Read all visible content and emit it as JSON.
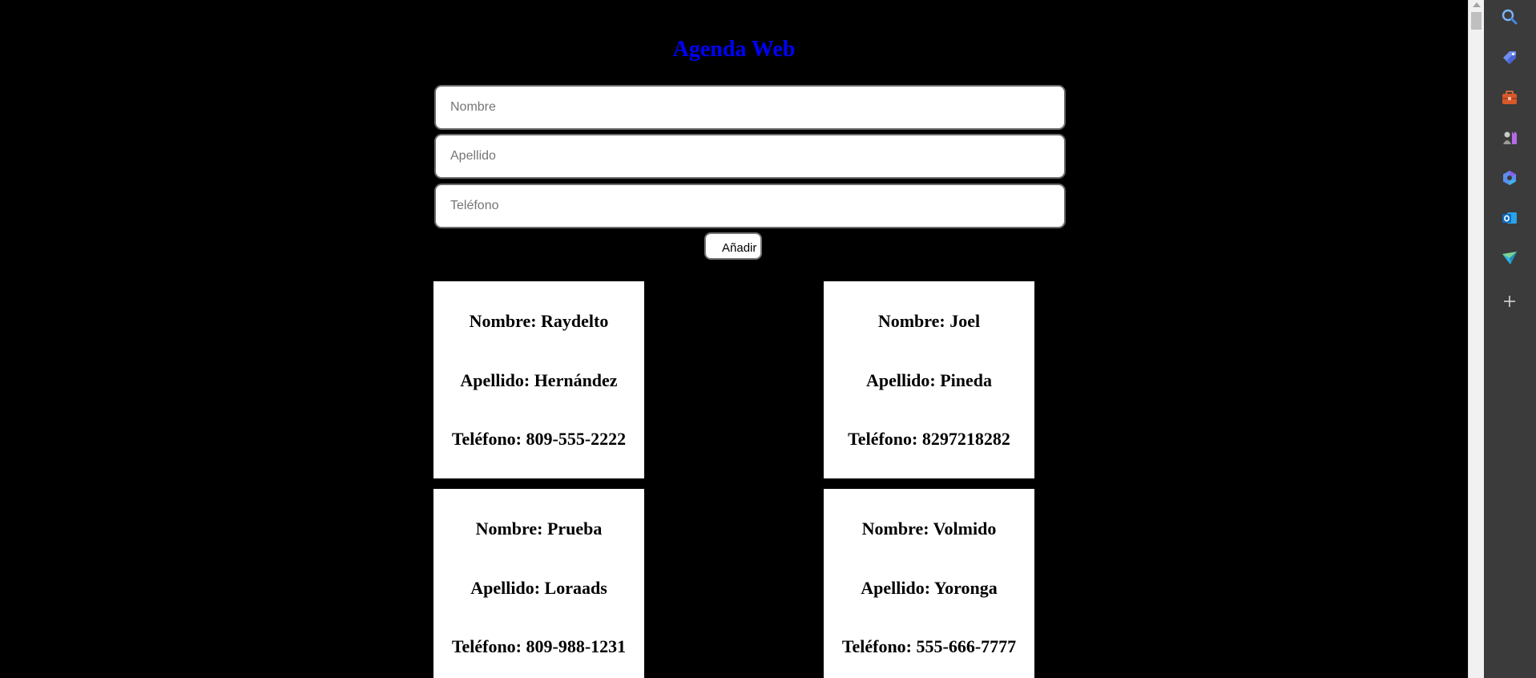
{
  "page": {
    "title": "Agenda Web"
  },
  "form": {
    "nombre_placeholder": "Nombre",
    "apellido_placeholder": "Apellido",
    "telefono_placeholder": "Teléfono",
    "add_label": "Añadir"
  },
  "contacts": [
    {
      "nombre": "Nombre: Raydelto",
      "apellido": "Apellido: Hernández",
      "telefono": "Teléfono: 809-555-2222"
    },
    {
      "nombre": "Nombre: Joel",
      "apellido": "Apellido: Pineda",
      "telefono": "Teléfono: 8297218282"
    },
    {
      "nombre": "Nombre: Prueba",
      "apellido": "Apellido: Loraads",
      "telefono": "Teléfono: 809-988-1231"
    },
    {
      "nombre": "Nombre: Volmido",
      "apellido": "Apellido: Yoronga",
      "telefono": "Teléfono: 555-666-7777"
    }
  ],
  "sidebar": {
    "icons": [
      "search-icon",
      "shopping-tag-icon",
      "toolbox-icon",
      "games-icon",
      "copilot-icon",
      "outlook-icon",
      "send-icon",
      "add-icon"
    ]
  },
  "colors": {
    "background": "#000000",
    "title": "#0000ff",
    "card": "#ffffff",
    "sidebar": "#3b3b3b"
  }
}
